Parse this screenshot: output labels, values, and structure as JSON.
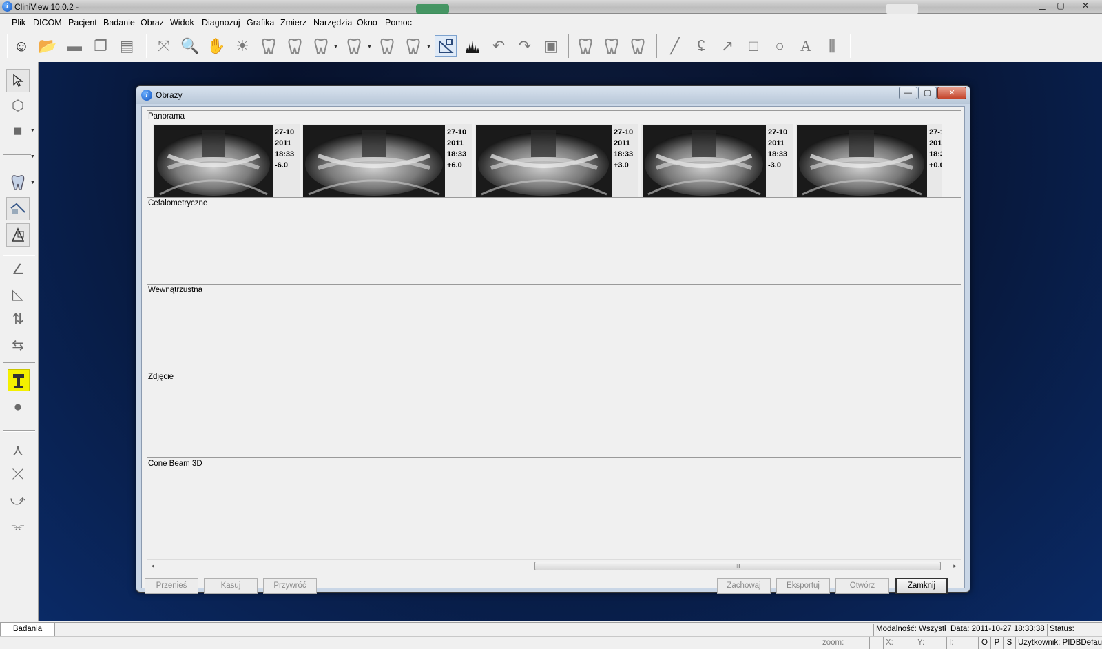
{
  "app": {
    "title": "CliniView 10.0.2 -",
    "min_glyph": "▁",
    "max_glyph": "▢",
    "close_glyph": "✕"
  },
  "menu": [
    "Plik",
    "DICOM",
    "Pacjent",
    "Badanie",
    "Obraz",
    "Widok",
    "Diagnozuj",
    "Grafika",
    "Zmierz",
    "Narzędzia",
    "Okno",
    "Pomoc"
  ],
  "toolbar_icons": {
    "patient": "☺",
    "open": "📂",
    "save": "▬",
    "copy": "❐",
    "stack": "▤",
    "fit": "⤧",
    "zoom": "🔍",
    "pan": "✋",
    "brightness": "☀",
    "tooth": "⚷"
  },
  "dialog": {
    "title": "Obrazy",
    "min_glyph": "—",
    "max_glyph": "▢",
    "close_glyph": "✕",
    "panels": [
      {
        "label": "Panorama"
      },
      {
        "label": "Cefalometryczne"
      },
      {
        "label": "Wewnątrzustna"
      },
      {
        "label": "Zdjęcie"
      },
      {
        "label": "Cone Beam 3D"
      }
    ],
    "thumbnails": [
      {
        "date": "27-10",
        "year": "2011",
        "time": "18:33",
        "offset": "-6.0"
      },
      {
        "date": "27-10",
        "year": "2011",
        "time": "18:33",
        "offset": "+6.0"
      },
      {
        "date": "27-10",
        "year": "2011",
        "time": "18:33",
        "offset": "+3.0"
      },
      {
        "date": "27-10",
        "year": "2011",
        "time": "18:33",
        "offset": "-3.0"
      },
      {
        "date": "27-1",
        "year": "201",
        "time": "18:3",
        "offset": "+0.0"
      }
    ],
    "scroll_left": "◂",
    "scroll_right": "▸",
    "scroll_grip": "III",
    "buttons_left": [
      "Przenieś",
      "Kasuj",
      "Przywróć"
    ],
    "buttons_right": [
      "Zachowaj",
      "Eksportuj",
      "Otwórz",
      "Zamknij"
    ]
  },
  "status": {
    "tab": "Badania",
    "modality": "Modalność: Wszystko",
    "date": "Data: 2011-10-27  18:33:38",
    "status": "Status:",
    "zoom": "zoom:",
    "x": "X:",
    "y": "Y:",
    "i": "I:",
    "o": "O",
    "p": "P",
    "s": "S",
    "user": "Użytkownik: PIDBDefaul"
  },
  "colors": {
    "workspace_top": "#07122d",
    "workspace_bottom": "#0a2a66",
    "highlight_tool": "#f4f000"
  }
}
